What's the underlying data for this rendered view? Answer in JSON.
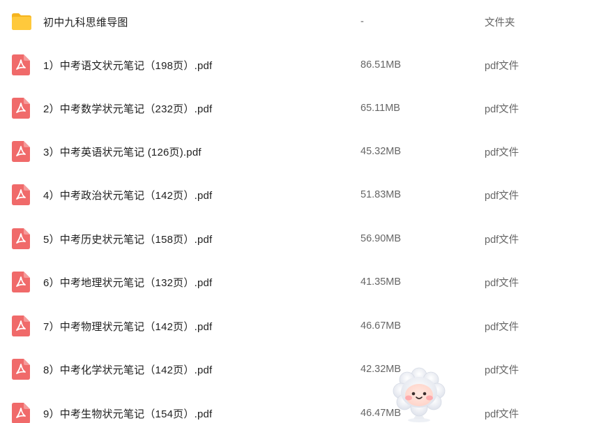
{
  "colors": {
    "folder": "#ffc93c",
    "folder_tab": "#f5b41f",
    "pdf_icon": "#f06a6a",
    "text_primary": "#1f1f1f",
    "text_secondary": "#666666"
  },
  "files": [
    {
      "icon": "folder-icon",
      "name": "初中九科思维导图",
      "size": "-",
      "type": "文件夹"
    },
    {
      "icon": "pdf-icon",
      "name": "1）中考语文状元笔记（198页）.pdf",
      "size": "86.51MB",
      "type": "pdf文件"
    },
    {
      "icon": "pdf-icon",
      "name": "2）中考数学状元笔记（232页）.pdf",
      "size": "65.11MB",
      "type": "pdf文件"
    },
    {
      "icon": "pdf-icon",
      "name": "3）中考英语状元笔记 (126页).pdf",
      "size": "45.32MB",
      "type": "pdf文件"
    },
    {
      "icon": "pdf-icon",
      "name": "4）中考政治状元笔记（142页）.pdf",
      "size": "51.83MB",
      "type": "pdf文件"
    },
    {
      "icon": "pdf-icon",
      "name": "5）中考历史状元笔记（158页）.pdf",
      "size": "56.90MB",
      "type": "pdf文件"
    },
    {
      "icon": "pdf-icon",
      "name": "6）中考地理状元笔记（132页）.pdf",
      "size": "41.35MB",
      "type": "pdf文件"
    },
    {
      "icon": "pdf-icon",
      "name": "7）中考物理状元笔记（142页）.pdf",
      "size": "46.67MB",
      "type": "pdf文件"
    },
    {
      "icon": "pdf-icon",
      "name": "8）中考化学状元笔记（142页）.pdf",
      "size": "42.32MB",
      "type": "pdf文件"
    },
    {
      "icon": "pdf-icon",
      "name": "9）中考生物状元笔记（154页）.pdf",
      "size": "46.47MB",
      "type": "pdf文件"
    }
  ],
  "mascot": {
    "icon": "cloud-mascot-icon"
  }
}
